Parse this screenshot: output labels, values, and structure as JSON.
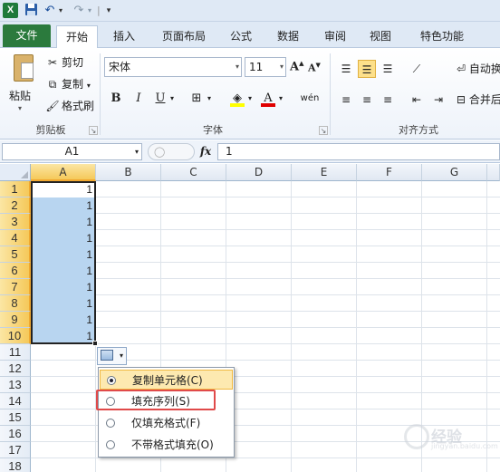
{
  "qat": {
    "logo_text": "X",
    "save_icon": "save-icon",
    "undo_icon": "undo-icon",
    "redo_icon": "redo-icon"
  },
  "tabs": [
    {
      "label": "文件"
    },
    {
      "label": "开始"
    },
    {
      "label": "插入"
    },
    {
      "label": "页面布局"
    },
    {
      "label": "公式"
    },
    {
      "label": "数据"
    },
    {
      "label": "审阅"
    },
    {
      "label": "视图"
    },
    {
      "label": "特色功能"
    }
  ],
  "ribbon": {
    "clipboard": {
      "group_label": "剪贴板",
      "paste_label": "粘贴",
      "cut_label": "剪切",
      "copy_label": "复制",
      "format_painter_label": "格式刷"
    },
    "font": {
      "group_label": "字体",
      "font_name": "宋体",
      "font_size": "11",
      "bold": "B",
      "italic": "I",
      "underline": "U",
      "font_color_letter": "A",
      "phonetic": "wén",
      "fill_color": "#ffff00",
      "font_color": "#e00000"
    },
    "alignment": {
      "group_label": "对齐方式",
      "wrap_text": "自动换",
      "merge_center": "合并后"
    }
  },
  "formula_bar": {
    "name_box": "A1",
    "fx": "fx",
    "value": "1"
  },
  "grid": {
    "columns": [
      "A",
      "B",
      "C",
      "D",
      "E",
      "F",
      "G"
    ],
    "rows": [
      "1",
      "2",
      "3",
      "4",
      "5",
      "6",
      "7",
      "8",
      "9",
      "10",
      "11",
      "12",
      "13",
      "14",
      "15",
      "16",
      "17",
      "18"
    ],
    "cell_values_col_a": [
      "1",
      "1",
      "1",
      "1",
      "1",
      "1",
      "1",
      "1",
      "1",
      "1"
    ],
    "selection_color": "#b8d5f0"
  },
  "autofill": {
    "options": [
      {
        "label": "复制单元格(C)",
        "selected": true
      },
      {
        "label": "填充序列(S)",
        "selected": false
      },
      {
        "label": "仅填充格式(F)",
        "selected": false
      },
      {
        "label": "不带格式填充(O)",
        "selected": false
      }
    ],
    "highlight_color": "#e04a4a"
  },
  "watermark": {
    "text": "经验",
    "url": "jingyan.baidu.com"
  }
}
